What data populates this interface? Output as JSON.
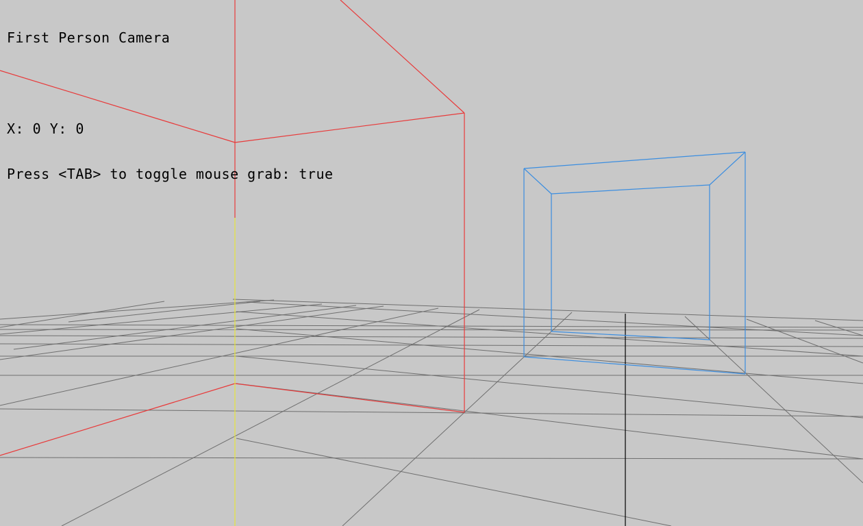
{
  "hud": {
    "title": "First Person Camera",
    "position_readout": "X: 0 Y: 0",
    "hint": "Press <TAB> to toggle mouse grab: true"
  },
  "colors": {
    "background": "#c8c8c8",
    "grid": "#6e6e6e",
    "red_box": "#e83a3a",
    "blue_box": "#3a8de0",
    "yellow_axis": "#e6e43a",
    "black_axis": "#000000"
  }
}
